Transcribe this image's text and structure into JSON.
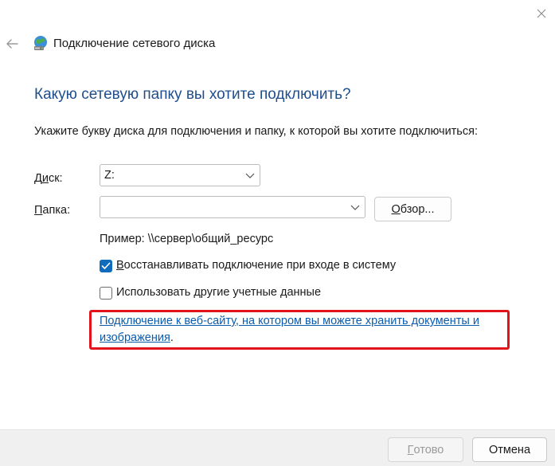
{
  "window": {
    "title": "Подключение сетевого диска"
  },
  "wizard": {
    "heading": "Какую сетевую папку вы хотите подключить?",
    "instruction": "Укажите букву диска для подключения и папку, к которой вы хотите подключиться:"
  },
  "drive": {
    "label_pre": "Д",
    "label_ul": "и",
    "label_post": "ск:",
    "value": "Z:"
  },
  "folder": {
    "label_ul": "П",
    "label_post": "апка:",
    "value": ""
  },
  "browse": {
    "label_pre": "",
    "label_ul": "О",
    "label_post": "бзор..."
  },
  "example": "Пример: \\\\сервер\\общий_ресурс",
  "options": {
    "reconnect": {
      "label_ul": "В",
      "label_post": "осстанавливать подключение при входе в систему",
      "checked": true
    },
    "other_creds": {
      "label_pre": "Использовать другие учетные ",
      "label_ul": "д",
      "label_post": "анные",
      "checked": false
    }
  },
  "web_link": {
    "text": "Подключение к веб-сайту, на котором вы можете хранить документы и изображения",
    "suffix": "."
  },
  "footer": {
    "finish": {
      "label_ul": "Г",
      "label_post": "отово"
    },
    "cancel": {
      "label": "Отмена"
    }
  },
  "colors": {
    "accent": "#0f6cbd",
    "heading": "#1f4e8c",
    "link": "#0b5cad",
    "highlight": "#e3131b"
  },
  "icons": [
    "close-icon",
    "back-arrow-icon",
    "network-drive-icon",
    "chevron-down-icon",
    "checkmark-icon"
  ]
}
